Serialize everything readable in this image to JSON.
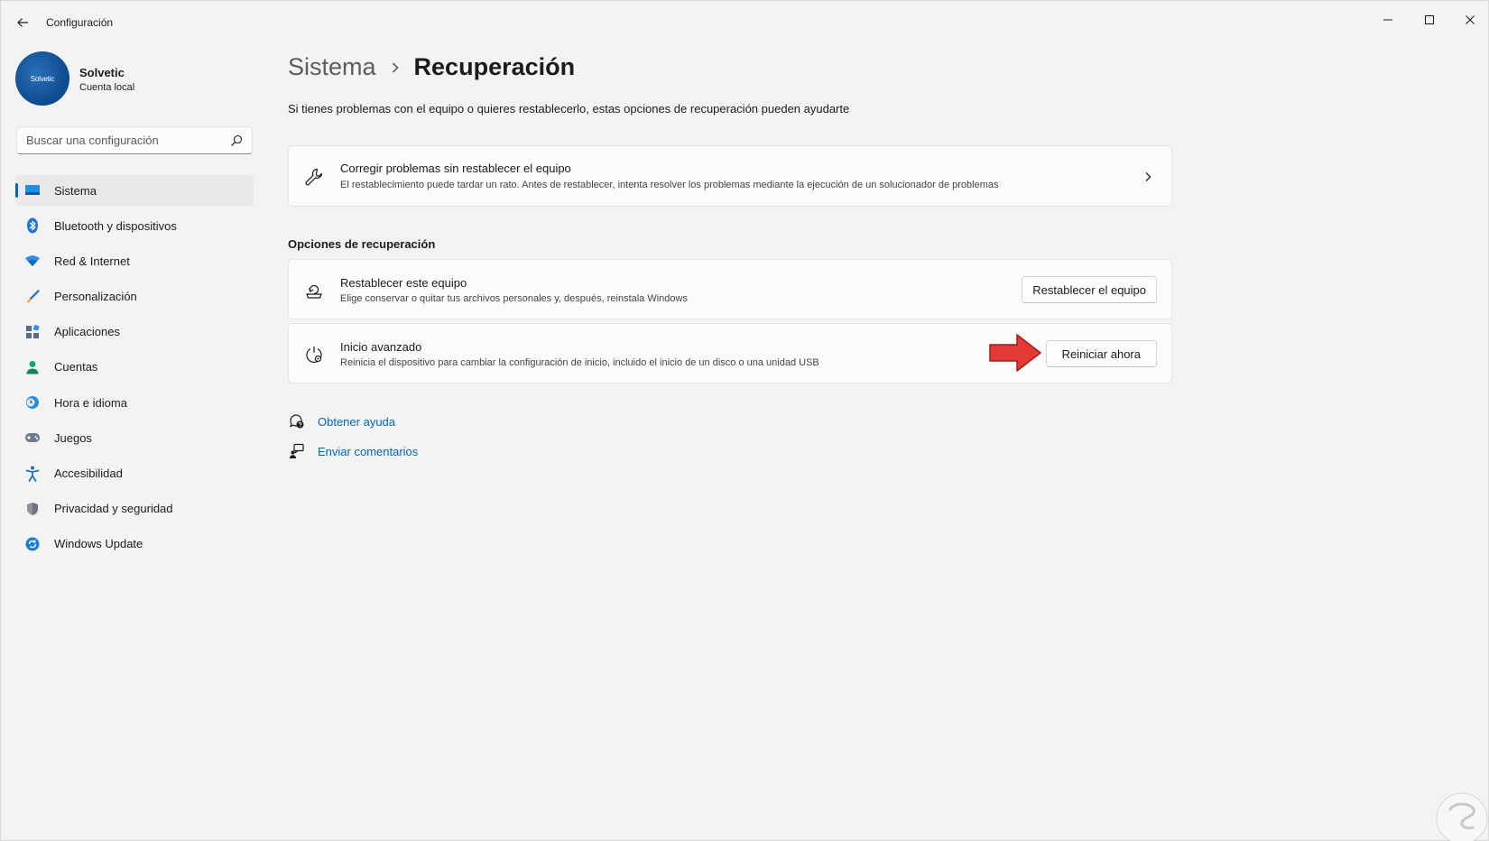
{
  "window": {
    "app_title": "Configuración"
  },
  "profile": {
    "avatar_text": "Solvetic",
    "name": "Solvetic",
    "account_type": "Cuenta local"
  },
  "search": {
    "placeholder": "Buscar una configuración"
  },
  "sidebar": {
    "items": [
      {
        "label": "Sistema",
        "icon": "monitor-icon",
        "active": true
      },
      {
        "label": "Bluetooth y dispositivos",
        "icon": "bluetooth-icon"
      },
      {
        "label": "Red & Internet",
        "icon": "wifi-icon"
      },
      {
        "label": "Personalización",
        "icon": "brush-icon"
      },
      {
        "label": "Aplicaciones",
        "icon": "apps-icon"
      },
      {
        "label": "Cuentas",
        "icon": "person-icon"
      },
      {
        "label": "Hora e idioma",
        "icon": "clock-globe-icon"
      },
      {
        "label": "Juegos",
        "icon": "gamepad-icon"
      },
      {
        "label": "Accesibilidad",
        "icon": "accessibility-icon"
      },
      {
        "label": "Privacidad y seguridad",
        "icon": "shield-icon"
      },
      {
        "label": "Windows Update",
        "icon": "update-icon"
      }
    ]
  },
  "breadcrumb": {
    "parent": "Sistema",
    "separator": "›",
    "current": "Recuperación"
  },
  "page": {
    "description": "Si tienes problemas con el equipo o quieres restablecerlo, estas opciones de recuperación pueden ayudarte"
  },
  "fix_card": {
    "title": "Corregir problemas sin restablecer el equipo",
    "subtitle": "El restablecimiento puede tardar un rato. Antes de restablecer, intenta resolver los problemas mediante la ejecución de un solucionador de problemas"
  },
  "recovery": {
    "section_title": "Opciones de recuperación",
    "reset": {
      "title": "Restablecer este equipo",
      "subtitle": "Elige conservar o quitar tus archivos personales y, después, reinstala Windows",
      "button": "Restablecer el equipo"
    },
    "advanced": {
      "title": "Inicio avanzado",
      "subtitle": "Reinicia el dispositivo para cambiar la configuración de inicio, incluido el inicio de un disco o una unidad USB",
      "button": "Reiniciar ahora"
    }
  },
  "links": {
    "help": "Obtener ayuda",
    "feedback": "Enviar comentarios"
  },
  "colors": {
    "accent": "#0067c0",
    "arrow": "#e53935"
  }
}
